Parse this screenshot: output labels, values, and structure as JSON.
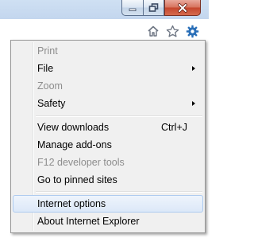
{
  "window": {
    "controls": {
      "minimize_icon": "minimize-icon",
      "maximize_icon": "maximize-icon",
      "close_icon": "close-icon"
    }
  },
  "toolbar": {
    "icons": [
      "home-icon",
      "favorites-star-icon",
      "tools-gear-icon"
    ],
    "gear_color": "#2a6fb8"
  },
  "menu": {
    "items": [
      {
        "label": "Print",
        "disabled": true
      },
      {
        "label": "File",
        "submenu": true
      },
      {
        "label": "Zoom",
        "disabled": true
      },
      {
        "label": "Safety",
        "submenu": true
      },
      {
        "label": "View downloads",
        "shortcut": "Ctrl+J"
      },
      {
        "label": "Manage add-ons"
      },
      {
        "label": "F12 developer tools",
        "disabled": true
      },
      {
        "label": "Go to pinned sites"
      },
      {
        "label": "Internet options",
        "highlighted": true
      },
      {
        "label": "About Internet Explorer"
      }
    ]
  },
  "colors": {
    "menu_background": "#f0f0f0",
    "highlight_border": "#aecbef",
    "disabled_text": "#8d8d8d"
  }
}
